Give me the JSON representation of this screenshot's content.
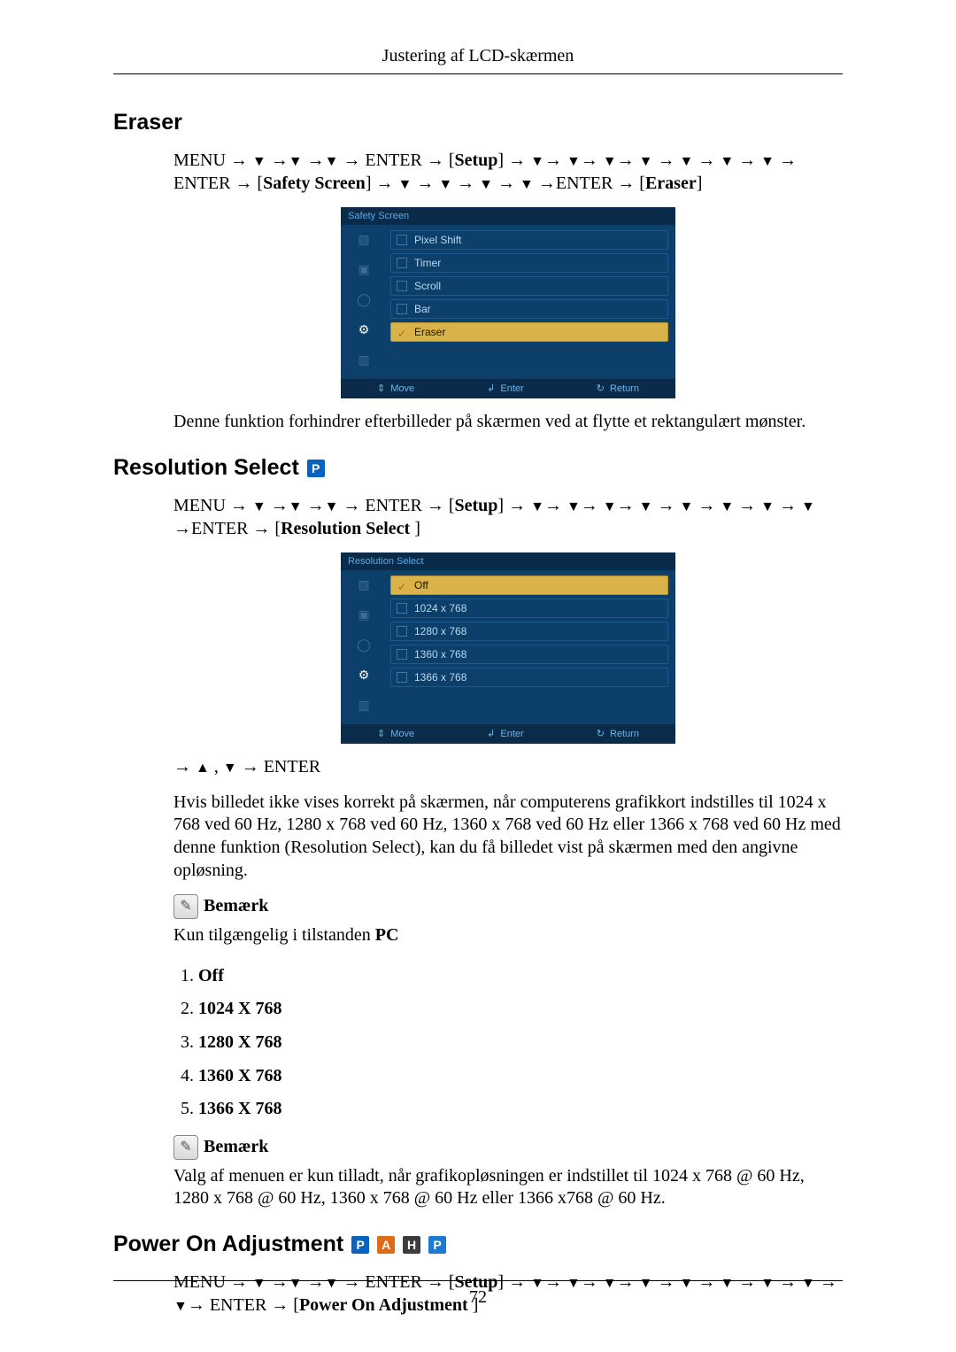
{
  "header": {
    "running": "Justering af LCD-skærmen",
    "page_number": "72"
  },
  "eraser": {
    "title": "Eraser",
    "path_plain": "MENU → ▼ →▼ →▼ → ENTER → [Setup] → ▼→ ▼→ ▼→ ▼ → ▼ → ▼ → ▼ → ENTER → [Safety Screen] → ▼ → ▼ → ▼ → ▼ →ENTER → [Eraser]",
    "osd": {
      "title": "Safety Screen",
      "items": [
        "Pixel Shift",
        "Timer",
        "Scroll",
        "Bar",
        "Eraser"
      ],
      "selected_index": 4,
      "footer": {
        "move": "Move",
        "enter": "Enter",
        "return": "Return"
      }
    },
    "description": "Denne funktion forhindrer efterbilleder på skærmen ved at flytte et rektangulært mønster."
  },
  "resolution": {
    "title": "Resolution Select",
    "path_plain": "MENU → ▼ →▼ →▼ → ENTER → [Setup] → ▼→ ▼→ ▼→ ▼ → ▼ → ▼ → ▼ → ▼ →ENTER → [Resolution Select ]",
    "osd": {
      "title": "Resolution Select",
      "items": [
        "Off",
        "1024 x 768",
        "1280 x 768",
        "1360 x 768",
        "1366 x 768"
      ],
      "selected_index": 0,
      "footer": {
        "move": "Move",
        "enter": "Enter",
        "return": "Return"
      }
    },
    "nav_hint": "→ ▲ , ▼ → ENTER",
    "description": "Hvis billedet ikke vises korrekt på skærmen, når computerens grafikkort indstilles til 1024 x 768 ved 60 Hz, 1280 x 768 ved 60 Hz, 1360 x 768 ved 60 Hz eller 1366 x 768 ved 60 Hz med denne funktion (Resolution Select), kan du få billedet vist på skærmen med den angivne opløsning.",
    "note_label": "Bemærk",
    "note1_text_prefix": "Kun tilgængelig i tilstanden ",
    "note1_text_bold": "PC",
    "options": [
      "Off",
      "1024 X 768",
      "1280 X 768",
      "1360 X 768",
      "1366 X 768"
    ],
    "note2_label": "Bemærk",
    "note2_text": "Valg af menuen er kun tilladt, når grafikopløsningen er indstillet til 1024 x 768 @ 60 Hz, 1280 x 768 @ 60 Hz, 1360 x 768 @ 60 Hz eller 1366 x768 @ 60 Hz."
  },
  "poweron": {
    "title": "Power On Adjustment",
    "path_plain": "MENU → ▼ →▼ →▼ → ENTER → [Setup] → ▼→ ▼→ ▼→ ▼ → ▼ → ▼ → ▼ → ▼ →▼→ ENTER → [Power On Adjustment ]"
  },
  "glyphs": {
    "down": "▼",
    "up": "▲",
    "right": "→",
    "check": "✓",
    "updown": "⇕",
    "enter": "↲",
    "return": "↻",
    "pencil": "✎"
  }
}
